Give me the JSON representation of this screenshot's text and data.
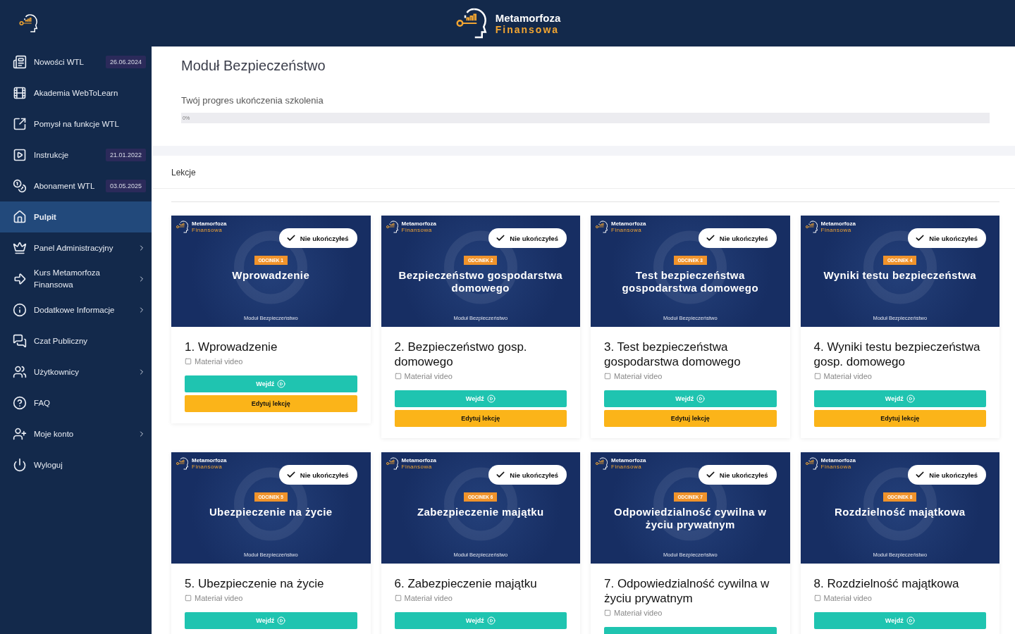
{
  "header": {
    "logo": {
      "line1": "Metamorfoza",
      "line2": "Finansowa"
    }
  },
  "sidebar": {
    "items": [
      {
        "kind": "news",
        "label": "Nowości WTL",
        "date": "26.06.2024",
        "selected": false,
        "has_children": false
      },
      {
        "kind": "film",
        "label": "Akademia WebToLearn",
        "selected": false,
        "has_children": false
      },
      {
        "kind": "external",
        "label": "Pomysł na funkcje WTL",
        "selected": false,
        "has_children": false
      },
      {
        "kind": "video",
        "label": "Instrukcje",
        "date": "21.01.2022",
        "selected": false,
        "has_children": false
      },
      {
        "kind": "coins",
        "label": "Abonament WTL",
        "date": "03.05.2025",
        "selected": false,
        "has_children": false
      },
      {
        "kind": "home",
        "label": "Pulpit",
        "selected": true,
        "has_children": false
      },
      {
        "kind": "crown",
        "label": "Panel Administracyjny",
        "selected": false,
        "has_children": true
      },
      {
        "kind": "arrow",
        "label": "Kurs Metamorfoza Finansowa",
        "selected": false,
        "has_children": true
      },
      {
        "kind": "info",
        "label": "Dodatkowe Informacje",
        "selected": false,
        "has_children": true
      },
      {
        "kind": "chat",
        "label": "Czat Publiczny",
        "selected": false,
        "has_children": false
      },
      {
        "kind": "users",
        "label": "Użytkownicy",
        "selected": false,
        "has_children": true
      },
      {
        "kind": "help",
        "label": "FAQ",
        "selected": false,
        "has_children": false
      },
      {
        "kind": "user",
        "label": "Moje konto",
        "selected": false,
        "has_children": true
      },
      {
        "kind": "power",
        "label": "Wyloguj",
        "selected": false,
        "has_children": false
      }
    ]
  },
  "module": {
    "title": "Moduł Bezpieczeństwo",
    "progress_label": "Twój progres ukończenia szkolenia",
    "progress": {
      "level": 0,
      "reading": "0%"
    }
  },
  "lessons": {
    "title": "Lekcje",
    "cards": [
      {
        "thumb": {
          "logo1": "Metamorfoza",
          "logo2": "Finansowa",
          "status": "Nie ukończyłeś",
          "episode": "ODCINEK 1",
          "title": "Wprowadzenie",
          "footer": "Moduł Bezpieczeństwo"
        },
        "title": "1. Wprowadzenie",
        "material": {
          "label": "Materiał video",
          "checked": false
        },
        "buttons": [
          {
            "kind": "enter",
            "label": "Wejdź"
          },
          {
            "kind": "edit",
            "label": "Edytuj lekcję"
          }
        ]
      },
      {
        "thumb": {
          "logo1": "Metamorfoza",
          "logo2": "Finansowa",
          "status": "Nie ukończyłeś",
          "episode": "ODCINEK 2",
          "title": "Bezpieczeństwo gospodarstwa domowego",
          "footer": "Moduł Bezpieczeństwo"
        },
        "title": "2. Bezpieczeństwo gosp. domowego",
        "material": {
          "label": "Materiał video",
          "checked": false
        },
        "buttons": [
          {
            "kind": "enter",
            "label": "Wejdź"
          },
          {
            "kind": "edit",
            "label": "Edytuj lekcję"
          }
        ]
      },
      {
        "thumb": {
          "logo1": "Metamorfoza",
          "logo2": "Finansowa",
          "status": "Nie ukończyłeś",
          "episode": "ODCINEK 3",
          "title": "Test bezpieczeństwa gospodarstwa domowego",
          "footer": "Moduł Bezpieczeństwo"
        },
        "title": "3. Test bezpieczeństwa gospodarstwa domowego",
        "material": {
          "label": "Materiał video",
          "checked": false
        },
        "buttons": [
          {
            "kind": "enter",
            "label": "Wejdź"
          },
          {
            "kind": "edit",
            "label": "Edytuj lekcję"
          }
        ]
      },
      {
        "thumb": {
          "logo1": "Metamorfoza",
          "logo2": "Finansowa",
          "status": "Nie ukończyłeś",
          "episode": "ODCINEK 4",
          "title": "Wyniki testu bezpieczeństwa",
          "footer": "Moduł Bezpieczeństwo"
        },
        "title": "4. Wyniki testu bezpieczeństwa gosp. domowego",
        "material": {
          "label": "Materiał video",
          "checked": false
        },
        "buttons": [
          {
            "kind": "enter",
            "label": "Wejdź"
          },
          {
            "kind": "edit",
            "label": "Edytuj lekcję"
          }
        ]
      },
      {
        "thumb": {
          "logo1": "Metamorfoza",
          "logo2": "Finansowa",
          "status": "Nie ukończyłeś",
          "episode": "ODCINEK 5",
          "title": "Ubezpieczenie na życie",
          "footer": "Moduł Bezpieczeństwo"
        },
        "title": "5. Ubezpieczenie na życie",
        "material": {
          "label": "Materiał video",
          "checked": false
        },
        "buttons": [
          {
            "kind": "enter",
            "label": "Wejdź"
          }
        ]
      },
      {
        "thumb": {
          "logo1": "Metamorfoza",
          "logo2": "Finansowa",
          "status": "Nie ukończyłeś",
          "episode": "ODCINEK 6",
          "title": "Zabezpieczenie majątku",
          "footer": "Moduł Bezpieczeństwo"
        },
        "title": "6. Zabezpieczenie majątku",
        "material": {
          "label": "Materiał video",
          "checked": false
        },
        "buttons": [
          {
            "kind": "enter",
            "label": "Wejdź"
          }
        ]
      },
      {
        "thumb": {
          "logo1": "Metamorfoza",
          "logo2": "Finansowa",
          "status": "Nie ukończyłeś",
          "episode": "ODCINEK 7",
          "title": "Odpowiedzialność cywilna w życiu prywatnym",
          "footer": "Moduł Bezpieczeństwo"
        },
        "title": "7. Odpowiedzialność cywilna w życiu prywatnym",
        "material": {
          "label": "Materiał video",
          "checked": false
        }
      },
      {
        "thumb": {
          "logo1": "Metamorfoza",
          "logo2": "Finansowa",
          "status": "Nie ukończyłeś",
          "episode": "ODCINEK 8",
          "title": "Rozdzielność majątkowa",
          "footer": "Moduł Bezpieczeństwo"
        },
        "title": "8. Rozdzielność majątkowa",
        "material": {
          "label": "Materiał video",
          "checked": false
        },
        "buttons": [
          {
            "kind": "enter",
            "label": "Wejdź"
          }
        ]
      }
    ]
  }
}
